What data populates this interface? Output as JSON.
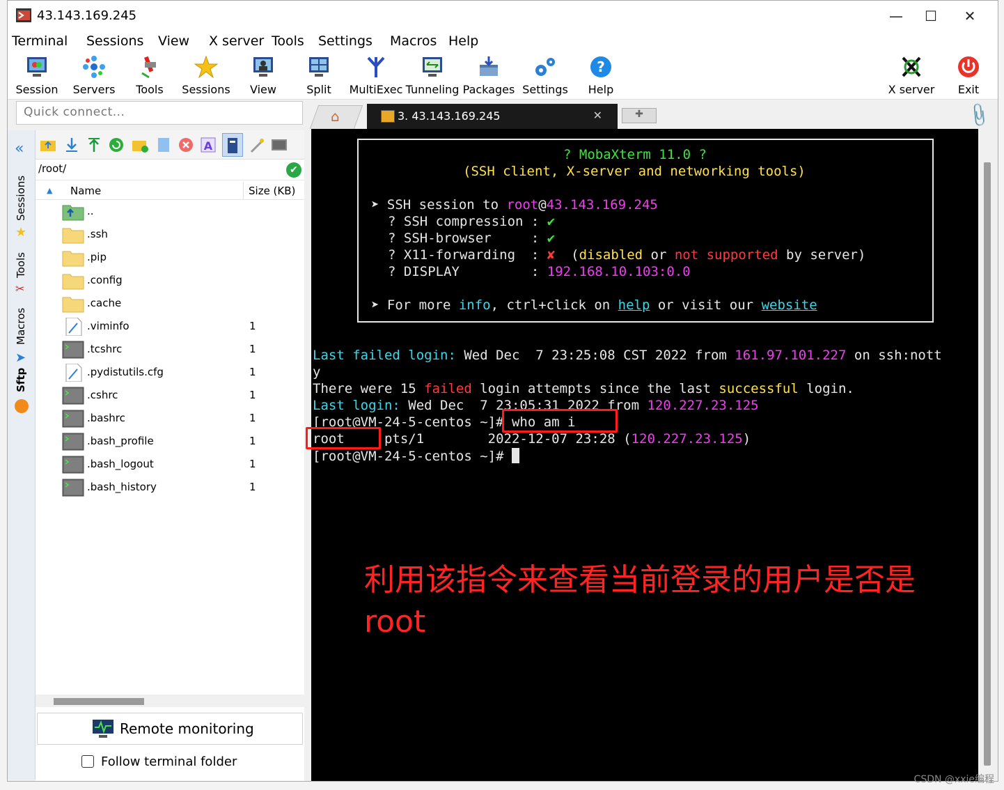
{
  "window": {
    "title": "43.143.169.245"
  },
  "menu": [
    "Terminal",
    "Sessions",
    "View",
    "X server",
    "Tools",
    "Settings",
    "Macros",
    "Help"
  ],
  "toolbar": [
    {
      "label": "Session",
      "icon": "session-icon"
    },
    {
      "label": "Servers",
      "icon": "servers-icon"
    },
    {
      "label": "Tools",
      "icon": "tools-icon"
    },
    {
      "label": "Sessions",
      "icon": "star-icon"
    },
    {
      "label": "View",
      "icon": "view-icon"
    },
    {
      "label": "Split",
      "icon": "split-icon"
    },
    {
      "label": "MultiExec",
      "icon": "multiexec-icon"
    },
    {
      "label": "Tunneling",
      "icon": "tunneling-icon"
    },
    {
      "label": "Packages",
      "icon": "packages-icon"
    },
    {
      "label": "Settings",
      "icon": "settings-icon"
    },
    {
      "label": "Help",
      "icon": "help-icon"
    },
    {
      "label": "X server",
      "icon": "xserver-icon"
    },
    {
      "label": "Exit",
      "icon": "exit-icon"
    }
  ],
  "quick_connect": {
    "placeholder": "Quick connect..."
  },
  "side_tabs": [
    "Sessions",
    "Tools",
    "Macros",
    "Sftp"
  ],
  "sftp": {
    "path": "/root/",
    "columns": {
      "name": "Name",
      "size": "Size (KB)"
    },
    "files": [
      {
        "name": "..",
        "size": "",
        "type": "up"
      },
      {
        "name": ".ssh",
        "size": "",
        "type": "folder"
      },
      {
        "name": ".pip",
        "size": "",
        "type": "folder"
      },
      {
        "name": ".config",
        "size": "",
        "type": "folder"
      },
      {
        "name": ".cache",
        "size": "",
        "type": "folder"
      },
      {
        "name": ".viminfo",
        "size": "1",
        "type": "file"
      },
      {
        "name": ".tcshrc",
        "size": "1",
        "type": "script"
      },
      {
        "name": ".pydistutils.cfg",
        "size": "1",
        "type": "file"
      },
      {
        "name": ".cshrc",
        "size": "1",
        "type": "script"
      },
      {
        "name": ".bashrc",
        "size": "1",
        "type": "script"
      },
      {
        "name": ".bash_profile",
        "size": "1",
        "type": "script"
      },
      {
        "name": ".bash_logout",
        "size": "1",
        "type": "script"
      },
      {
        "name": ".bash_history",
        "size": "1",
        "type": "script"
      }
    ],
    "remote_monitoring": "Remote monitoring",
    "follow_terminal": "Follow terminal folder"
  },
  "tabs": {
    "session_label": "3. 43.143.169.245"
  },
  "terminal": {
    "banner_title": "? MobaXterm 11.0 ?",
    "banner_subtitle": "(SSH client, X-server and networking tools)",
    "ssh_prefix": "➤ SSH session to ",
    "ssh_user": "root",
    "ssh_at": "@",
    "ssh_host": "43.143.169.245",
    "compression_label": "? SSH compression : ",
    "browser_label": "? SSH-browser     : ",
    "x11_label": "? X11-forwarding  : ",
    "display_label": "? DISPLAY         : ",
    "check": "✔",
    "cross": "✘",
    "x11_open": "  (",
    "x11_disabled": "disabled",
    "x11_or": " or ",
    "x11_not_supported": "not supported",
    "x11_by": " by server)",
    "display_value": "192.168.10.103:0.0",
    "more_prefix": "➤ For more ",
    "more_info": "info",
    "more_mid": ", ctrl+click on ",
    "more_help": "help",
    "more_visit": " or visit our ",
    "more_website": "website",
    "failed_label": "Last failed login:",
    "failed_text": " Wed Dec  7 23:25:08 CST 2022 from ",
    "failed_ip": "161.97.101.227",
    "failed_suffix": " on ssh:nott",
    "failed_wrap": "y",
    "there_were_a": "There were 15 ",
    "there_were_failed": "failed",
    "there_were_b": " login attempts since the last ",
    "there_were_successful": "successful",
    "there_were_c": " login.",
    "last_label": "Last login:",
    "last_text": " Wed Dec  7 23:05:31 2022 from ",
    "last_ip": "120.227.23.125",
    "prompt": "[root@VM-24-5-centos ~]#",
    "command": " who am i",
    "out_user": "root",
    "out_tty": "     pts/1        2022-12-07 23:28 (",
    "out_ip": "120.227.23.125",
    "out_close": ")",
    "prompt2": "[root@VM-24-5-centos ~]# "
  },
  "annotation": "利用该指令来查看当前登录的用户是否是root",
  "watermark": "CSDN @xxie编程"
}
